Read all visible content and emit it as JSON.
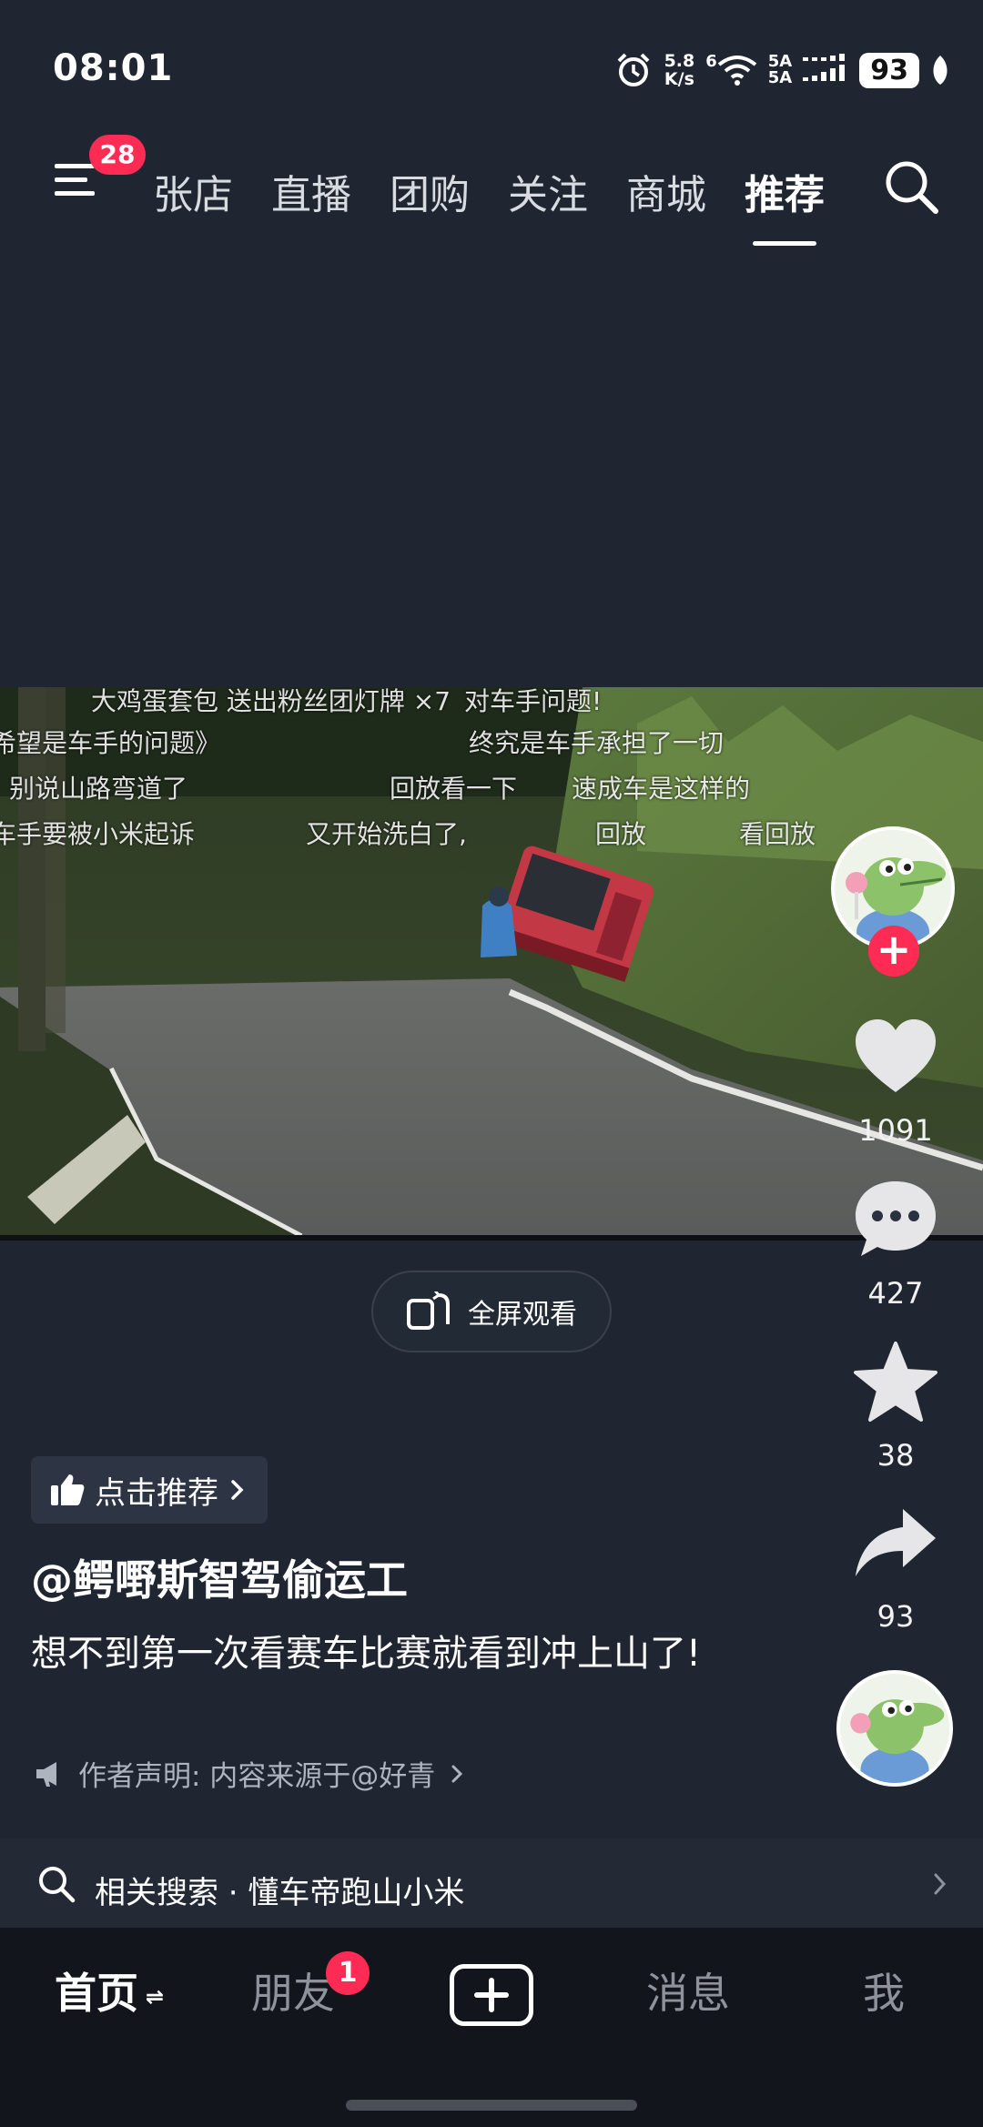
{
  "status_bar": {
    "time": "08:01",
    "net_speed_value": "5.8",
    "net_speed_unit": "K/s",
    "wifi_label": "6",
    "signal_label_1": "5A",
    "signal_label_2": "5A",
    "battery": "93"
  },
  "top_nav": {
    "menu_badge": "28",
    "tabs": [
      {
        "label": "张店"
      },
      {
        "label": "直播"
      },
      {
        "label": "团购"
      },
      {
        "label": "关注"
      },
      {
        "label": "商城"
      },
      {
        "label": "推荐"
      }
    ],
    "active_tab": "推荐"
  },
  "video": {
    "danmaku": [
      "大鸡蛋套包 送出粉丝团灯牌 ×7",
      "对车手问题!",
      "希望是车手的问题》",
      "终究是车手承担了一切",
      "别说山路弯道了",
      "回放看一下",
      "速成车是这样的",
      "车手要被小米起诉",
      "又开始洗白了,",
      "回放",
      "看回放"
    ]
  },
  "fullscreen": {
    "label": "全屏观看"
  },
  "actions": {
    "likes": "1091",
    "comments": "427",
    "favorites": "38",
    "shares": "93"
  },
  "caption": {
    "recommend_label": "点击推荐",
    "author": "@鳄嘢斯智驾偷运工",
    "description": "想不到第一次看赛车比赛就看到冲上山了!",
    "statement": "作者声明: 内容来源于@好青"
  },
  "related": {
    "label": "相关搜索 · 懂车帝跑山小米"
  },
  "bottom_nav": {
    "home": "首页",
    "friends": "朋友",
    "friends_badge": "1",
    "messages": "消息",
    "me": "我"
  },
  "colors": {
    "background": "#1f2632",
    "accent": "#fe2c55",
    "bottom_nav": "#12161c"
  }
}
